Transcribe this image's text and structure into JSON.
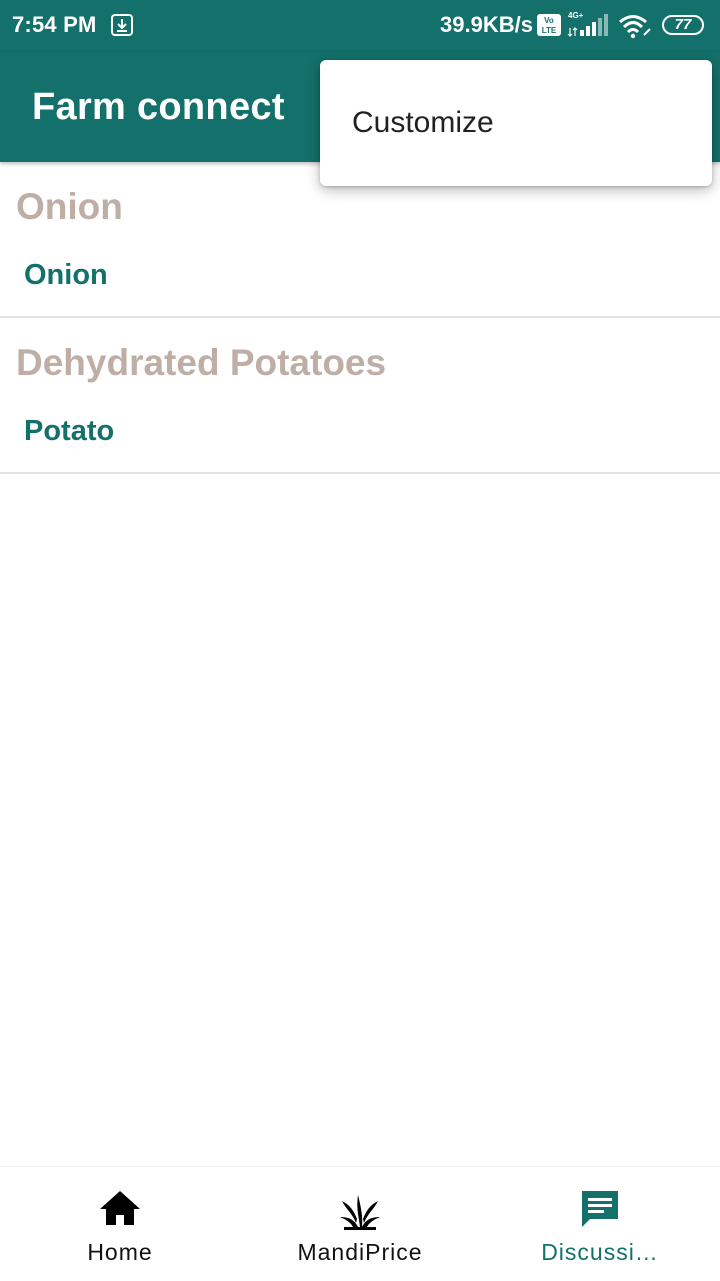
{
  "status_bar": {
    "time": "7:54 PM",
    "net_speed": "39.9KB/s",
    "network_type": "4G+",
    "volte": "Vo LTE",
    "battery": "77"
  },
  "app_bar": {
    "title": "Farm connect"
  },
  "overflow_menu": {
    "items": [
      {
        "label": "Customize"
      }
    ]
  },
  "topics": [
    {
      "title": "Onion",
      "subtitle": "Onion"
    },
    {
      "title": "Dehydrated Potatoes",
      "subtitle": "Potato"
    }
  ],
  "bottom_nav": {
    "items": [
      {
        "label": "Home",
        "icon": "home-icon",
        "active": false
      },
      {
        "label": "MandiPrice",
        "icon": "sprout-icon",
        "active": false
      },
      {
        "label": "Discussi…",
        "icon": "chat-icon",
        "active": true
      }
    ]
  },
  "colors": {
    "primary": "#14706a",
    "topic_title": "#bfaea6",
    "divider": "#e2e2e2"
  }
}
